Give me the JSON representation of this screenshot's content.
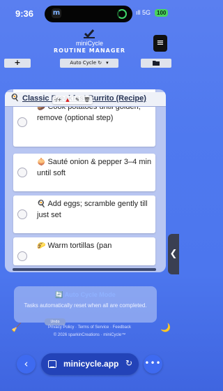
{
  "status_bar": {
    "time": "9:36",
    "signal": "5G",
    "battery": "100"
  },
  "header": {
    "brand": "miniCycle",
    "subtitle": "ROUTINE MANAGER",
    "menu_icon": "≡"
  },
  "toolbar": {
    "add_label": "+",
    "cycle_select": "Auto Cycle ↻",
    "caret": "▾",
    "folder_icon": "folder-icon"
  },
  "card": {
    "title_icon": "🍳",
    "title": "Classic Breakfast Burrito (Recipe)",
    "tasks": [
      {
        "emoji": "🥔",
        "text": "Cook potatoes until golden; remove (optional step)"
      },
      {
        "emoji": "🧅",
        "text": "Sauté onion & pepper 3–4 min until soft"
      },
      {
        "emoji": "🍳",
        "text": "Add eggs; scramble gently till just set"
      },
      {
        "emoji": "🌮",
        "text": "Warm tortillas (pan"
      }
    ],
    "actions": [
      "-/+",
      "▲",
      "✎",
      "🗑"
    ]
  },
  "side_handle": "❮",
  "auto_cycle": {
    "icon": "🔄",
    "title": "Auto Cycle Mode",
    "description": "Tasks automatically reset when all are completed.",
    "pill": "Undo"
  },
  "footer": {
    "links": "Privacy Policy · Terms of Service · Feedback",
    "copyright": "© 2026 sparkinCreations · miniCycle™"
  },
  "decor": {
    "broom": "🧹",
    "moon": "🌙"
  },
  "browser": {
    "url": "minicycle.app",
    "back": "‹",
    "more": "•••",
    "reload": "↻"
  }
}
